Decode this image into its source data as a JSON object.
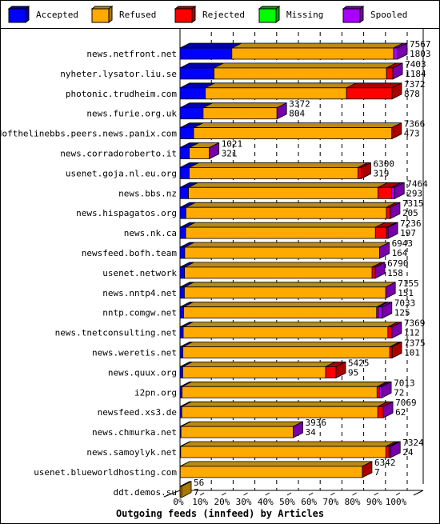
{
  "chart_data": {
    "type": "bar",
    "orientation": "horizontal",
    "stacked": true,
    "title": "Outgoing feeds (innfeed) by Articles",
    "xlabel": "Outgoing feeds (innfeed) by Articles",
    "ylabel": "",
    "xlim": [
      0,
      100
    ],
    "x_ticks": [
      "0%",
      "10%",
      "20%",
      "30%",
      "40%",
      "50%",
      "60%",
      "70%",
      "80%",
      "90%",
      "100%"
    ],
    "grid": true,
    "legend_position": "top",
    "legend": [
      {
        "name": "Accepted",
        "color": "#0000ff",
        "side": "#0000a8",
        "top": "#0000a8"
      },
      {
        "name": "Refused",
        "color": "#ffaa00",
        "side": "#aa7700",
        "top": "#b88a16"
      },
      {
        "name": "Rejected",
        "color": "#ff0000",
        "side": "#aa0000",
        "top": "#aa0000"
      },
      {
        "name": "Missing",
        "color": "#00ff00",
        "side": "#00a800",
        "top": "#00a800"
      },
      {
        "name": "Spooled",
        "color": "#aa00ff",
        "side": "#7700aa",
        "top": "#7700aa"
      }
    ],
    "categories": [
      "news.netfront.net",
      "nyheter.lysator.liu.se",
      "photonic.trudheim.com",
      "news.furie.org.uk",
      "endofthelinebbs.peers.news.panix.com",
      "news.corradoroberto.it",
      "usenet.goja.nl.eu.org",
      "news.bbs.nz",
      "news.hispagatos.org",
      "news.nk.ca",
      "newsfeed.bofh.team",
      "usenet.network",
      "news.nntp4.net",
      "nntp.comgw.net",
      "news.tnetconsulting.net",
      "news.weretis.net",
      "news.quux.org",
      "i2pn.org",
      "newsfeed.xs3.de",
      "news.chmurka.net",
      "news.samoylyk.net",
      "usenet.blueworldhosting.com",
      "ddt.demos.su"
    ],
    "totals": [
      7567,
      7403,
      7372,
      3372,
      7366,
      1021,
      6300,
      7464,
      7315,
      7236,
      6943,
      6790,
      7155,
      7033,
      7369,
      7375,
      5425,
      7013,
      7069,
      3936,
      7324,
      6342,
      56
    ],
    "series": [
      {
        "name": "Accepted",
        "values": [
          1803,
          1184,
          878,
          804,
          473,
          321,
          319,
          293,
          205,
          197,
          164,
          158,
          151,
          125,
          112,
          101,
          95,
          72,
          62,
          34,
          24,
          7,
          7
        ]
      },
      {
        "name": "Refused",
        "values": [
          5624,
          5999,
          4914,
          2568,
          6893,
          700,
          5871,
          6591,
          6970,
          6599,
          6779,
          6522,
          7004,
          6713,
          7117,
          7194,
          4970,
          6781,
          6817,
          3902,
          7135,
          6335,
          49
        ]
      },
      {
        "name": "Rejected",
        "values": [
          0,
          220,
          1580,
          0,
          0,
          0,
          110,
          470,
          140,
          390,
          0,
          110,
          0,
          55,
          140,
          80,
          360,
          80,
          190,
          0,
          110,
          0,
          0
        ]
      },
      {
        "name": "Missing",
        "values": [
          0,
          0,
          0,
          0,
          0,
          0,
          0,
          0,
          0,
          0,
          0,
          0,
          0,
          0,
          0,
          0,
          0,
          0,
          0,
          0,
          0,
          0,
          0
        ]
      },
      {
        "name": "Spooled",
        "values": [
          140,
          0,
          0,
          0,
          0,
          0,
          0,
          110,
          0,
          50,
          0,
          0,
          0,
          140,
          0,
          0,
          0,
          80,
          0,
          0,
          55,
          0,
          0
        ]
      }
    ],
    "side_colors": [
      "Spooled",
      "Spooled",
      "Rejected",
      "Spooled",
      "Rejected",
      "Spooled",
      "Rejected",
      "Spooled",
      "Spooled",
      "Spooled",
      "Spooled",
      "Spooled",
      "Spooled",
      "Spooled",
      "Spooled",
      "Rejected",
      "Rejected",
      "Spooled",
      "Spooled",
      "Spooled",
      "Spooled",
      "Rejected",
      "Refused"
    ]
  }
}
